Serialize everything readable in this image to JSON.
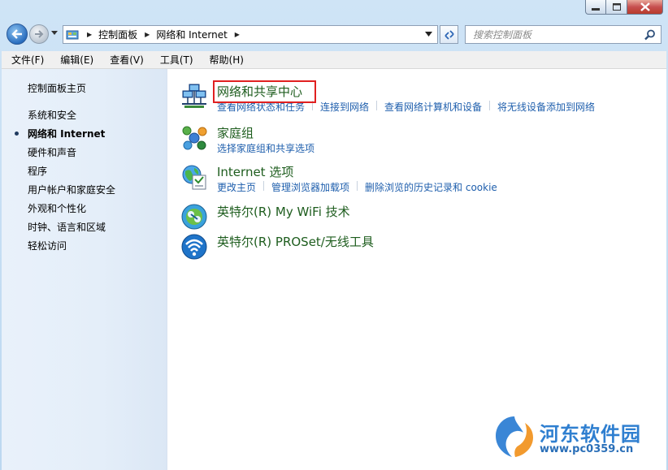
{
  "address": {
    "crumbs": [
      "控制面板",
      "网络和 Internet"
    ]
  },
  "search": {
    "placeholder": "搜索控制面板"
  },
  "menu": [
    "文件(F)",
    "编辑(E)",
    "查看(V)",
    "工具(T)",
    "帮助(H)"
  ],
  "sidebar": {
    "home": "控制面板主页",
    "items": [
      "系统和安全",
      "网络和 Internet",
      "硬件和声音",
      "程序",
      "用户帐户和家庭安全",
      "外观和个性化",
      "时钟、语言和区域",
      "轻松访问"
    ],
    "active_index": 1
  },
  "categories": [
    {
      "title": "网络和共享中心",
      "icon": "network-sharing-icon",
      "links": [
        "查看网络状态和任务",
        "连接到网络",
        "查看网络计算机和设备",
        "将无线设备添加到网络"
      ]
    },
    {
      "title": "家庭组",
      "icon": "homegroup-icon",
      "links": [
        "选择家庭组和共享选项"
      ]
    },
    {
      "title": "Internet 选项",
      "icon": "internet-options-icon",
      "links": [
        "更改主页",
        "管理浏览器加载项",
        "删除浏览的历史记录和 cookie"
      ]
    },
    {
      "title": "英特尔(R) My WiFi 技术",
      "icon": "intel-mywifi-icon",
      "links": []
    },
    {
      "title": "英特尔(R) PROSet/无线工具",
      "icon": "intel-proset-wireless-icon",
      "links": []
    }
  ],
  "watermark": {
    "title": "河东软件园",
    "url": "www.pc0359.cn"
  },
  "colors": {
    "highlight": "#e02020",
    "link": "#1f5fad",
    "category_title": "#1e5d1e"
  }
}
